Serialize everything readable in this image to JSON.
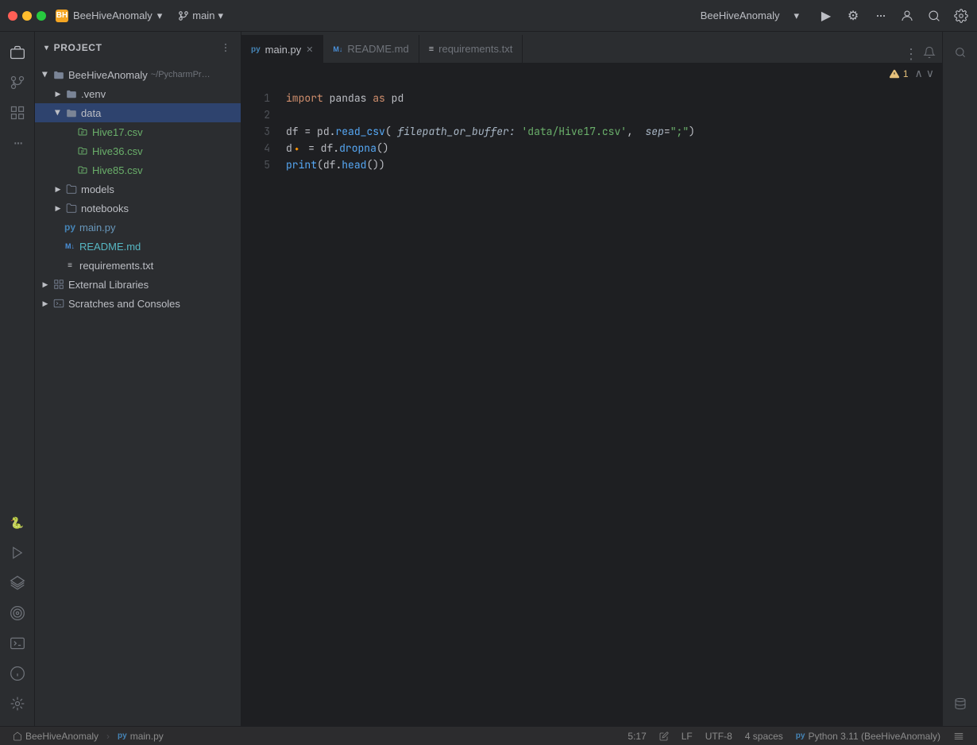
{
  "titlebar": {
    "app_icon": "BH",
    "project_name": "BeeHiveAnomaly",
    "branch": "main",
    "branch_chevron": "▾",
    "run_btn": "▶",
    "debug_icon": "⚙",
    "more_icon": "⋯",
    "user_icon": "👤",
    "search_icon": "🔍",
    "settings_icon": "⚙"
  },
  "activity_bar": {
    "icons": [
      {
        "name": "folder-icon",
        "symbol": "📁",
        "active": true
      },
      {
        "name": "git-icon",
        "symbol": "⎇"
      },
      {
        "name": "structure-icon",
        "symbol": "⊞"
      },
      {
        "name": "more-icon",
        "symbol": "•••"
      }
    ],
    "bottom_icons": [
      {
        "name": "python-icon",
        "symbol": "🐍"
      },
      {
        "name": "run-icon",
        "symbol": "▷"
      },
      {
        "name": "layers-icon",
        "symbol": "≡"
      },
      {
        "name": "target-icon",
        "symbol": "◎"
      },
      {
        "name": "terminal-icon",
        "symbol": "⬛"
      },
      {
        "name": "info-icon",
        "symbol": "ℹ"
      },
      {
        "name": "git-bottom-icon",
        "symbol": "⚙"
      }
    ]
  },
  "sidebar": {
    "header": "Project",
    "header_chevron": "▾",
    "tree": [
      {
        "id": "root",
        "level": 0,
        "expanded": true,
        "type": "folder",
        "name": "BeeHiveAnomaly",
        "suffix": "~/PycharmPr…",
        "color": "default"
      },
      {
        "id": "venv",
        "level": 1,
        "expanded": false,
        "type": "folder",
        "name": ".venv",
        "color": "default"
      },
      {
        "id": "data",
        "level": 1,
        "expanded": true,
        "type": "folder",
        "name": "data",
        "color": "default",
        "selected": true
      },
      {
        "id": "hive17",
        "level": 2,
        "expanded": false,
        "type": "csv",
        "name": "Hive17.csv",
        "color": "green"
      },
      {
        "id": "hive36",
        "level": 2,
        "expanded": false,
        "type": "csv",
        "name": "Hive36.csv",
        "color": "green"
      },
      {
        "id": "hive85",
        "level": 2,
        "expanded": false,
        "type": "csv",
        "name": "Hive85.csv",
        "color": "green"
      },
      {
        "id": "models",
        "level": 1,
        "expanded": false,
        "type": "folder",
        "name": "models",
        "color": "default"
      },
      {
        "id": "notebooks",
        "level": 1,
        "expanded": false,
        "type": "folder",
        "name": "notebooks",
        "color": "default"
      },
      {
        "id": "mainpy",
        "level": 1,
        "expanded": false,
        "type": "py",
        "name": "main.py",
        "color": "blue"
      },
      {
        "id": "readme",
        "level": 1,
        "expanded": false,
        "type": "md",
        "name": "README.md",
        "color": "cyan"
      },
      {
        "id": "requirements",
        "level": 1,
        "expanded": false,
        "type": "txt",
        "name": "requirements.txt",
        "color": "default"
      },
      {
        "id": "ext-libs",
        "level": 0,
        "expanded": false,
        "type": "lib",
        "name": "External Libraries",
        "color": "default"
      },
      {
        "id": "scratches",
        "level": 0,
        "expanded": false,
        "type": "scratch",
        "name": "Scratches and Consoles",
        "color": "default"
      }
    ]
  },
  "tabs": [
    {
      "id": "main-py",
      "label": "main.py",
      "type": "py",
      "active": true,
      "closable": true
    },
    {
      "id": "readme-md",
      "label": "README.md",
      "type": "md",
      "active": false,
      "closable": false
    },
    {
      "id": "requirements-txt",
      "label": "requirements.txt",
      "type": "txt",
      "active": false,
      "closable": false
    }
  ],
  "editor": {
    "warning_count": "1",
    "lines": [
      {
        "num": "1",
        "tokens": [
          {
            "type": "kw-import",
            "text": "import "
          },
          {
            "type": "kw-var",
            "text": "pandas "
          },
          {
            "type": "kw-as",
            "text": "as "
          },
          {
            "type": "kw-var",
            "text": "pd"
          }
        ]
      },
      {
        "num": "2",
        "tokens": []
      },
      {
        "num": "3",
        "tokens": [
          {
            "type": "kw-var",
            "text": "df "
          },
          {
            "type": "kw-separator",
            "text": "= "
          },
          {
            "type": "kw-var",
            "text": "pd"
          },
          {
            "type": "kw-separator",
            "text": "."
          },
          {
            "type": "kw-func",
            "text": "read_csv"
          },
          {
            "type": "kw-separator",
            "text": "( "
          },
          {
            "type": "kw-param-name",
            "text": "filepath_or_buffer:"
          },
          {
            "type": "kw-separator",
            "text": " "
          },
          {
            "type": "kw-string",
            "text": "'data/Hive17.csv'"
          },
          {
            "type": "kw-separator",
            "text": ",  "
          },
          {
            "type": "kw-param-name",
            "text": "sep"
          },
          {
            "type": "kw-separator",
            "text": "="
          },
          {
            "type": "kw-string",
            "text": "\";\""
          },
          {
            "type": "kw-separator",
            "text": ")"
          }
        ]
      },
      {
        "num": "4",
        "tokens": [
          {
            "type": "kw-var",
            "text": "d"
          },
          {
            "type": "kw-warning-dot",
            "text": "🔸"
          },
          {
            "type": "kw-separator",
            "text": " = "
          },
          {
            "type": "kw-var",
            "text": "df"
          },
          {
            "type": "kw-separator",
            "text": "."
          },
          {
            "type": "kw-func",
            "text": "dropna"
          },
          {
            "type": "kw-separator",
            "text": "()"
          }
        ]
      },
      {
        "num": "5",
        "tokens": [
          {
            "type": "kw-print",
            "text": "print"
          },
          {
            "type": "kw-separator",
            "text": "("
          },
          {
            "type": "kw-var",
            "text": "df"
          },
          {
            "type": "kw-separator",
            "text": "."
          },
          {
            "type": "kw-func",
            "text": "head"
          },
          {
            "type": "kw-separator",
            "text": "())"
          }
        ]
      }
    ]
  },
  "status_bar": {
    "project": "BeeHiveAnomaly",
    "file": "main.py",
    "cursor": "5:17",
    "edit_icon": "✏",
    "line_ending": "LF",
    "encoding": "UTF-8",
    "indent": "4 spaces",
    "python_version": "Python 3.11 (BeeHiveAnomaly)",
    "indent_icon": "⇥"
  }
}
